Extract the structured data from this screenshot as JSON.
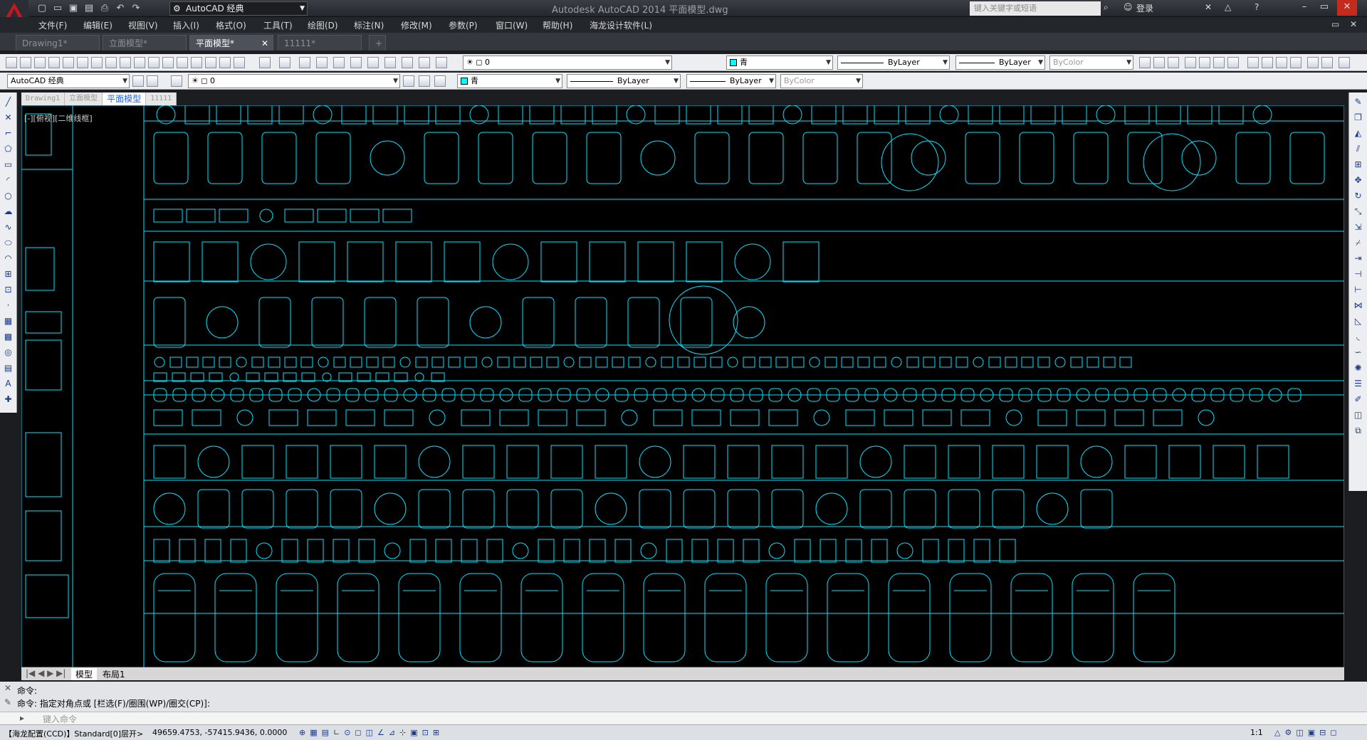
{
  "title_bar": {
    "workspace": "AutoCAD 经典",
    "window_title": "Autodesk AutoCAD 2014    平面模型.dwg",
    "search_placeholder": "键入关键字或短语",
    "login": "登录"
  },
  "menu": [
    "文件(F)",
    "编辑(E)",
    "视图(V)",
    "插入(I)",
    "格式(O)",
    "工具(T)",
    "绘图(D)",
    "标注(N)",
    "修改(M)",
    "参数(P)",
    "窗口(W)",
    "帮助(H)",
    "海龙设计软件(L)"
  ],
  "doc_tabs": [
    {
      "label": "Drawing1*",
      "active": false
    },
    {
      "label": "立面模型*",
      "active": false
    },
    {
      "label": "平面模型*",
      "active": true
    },
    {
      "label": "11111*",
      "active": false
    }
  ],
  "toolbar1": {
    "layer": "0",
    "color": "青",
    "linetype": "ByLayer",
    "lineweight": "ByLayer",
    "plotstyle": "ByColor"
  },
  "toolbar2": {
    "workspace": "AutoCAD 经典",
    "layer": "0",
    "color": "青",
    "linetype": "ByLayer",
    "lineweight": "ByLayer",
    "plotstyle": "ByColor"
  },
  "inner_tabs": [
    "Drawing1",
    "立面模型",
    "平面模型",
    "11111"
  ],
  "viewport_label": "[-][俯视][二维线框]",
  "layout_tabs": [
    "模型",
    "布局1"
  ],
  "command": {
    "line1": "命令:",
    "line2": "命令: 指定对角点或 [栏选(F)/圈围(WP)/圈交(CP)]:",
    "placeholder": "键入命令"
  },
  "status": {
    "left": "【海龙配置(CCD)】Standard[0]层开>",
    "coords": "49659.4753, -57415.9436, 0.0000",
    "scale": "1:1"
  },
  "colors": {
    "accent": "#00e5ff",
    "background": "#000000"
  }
}
